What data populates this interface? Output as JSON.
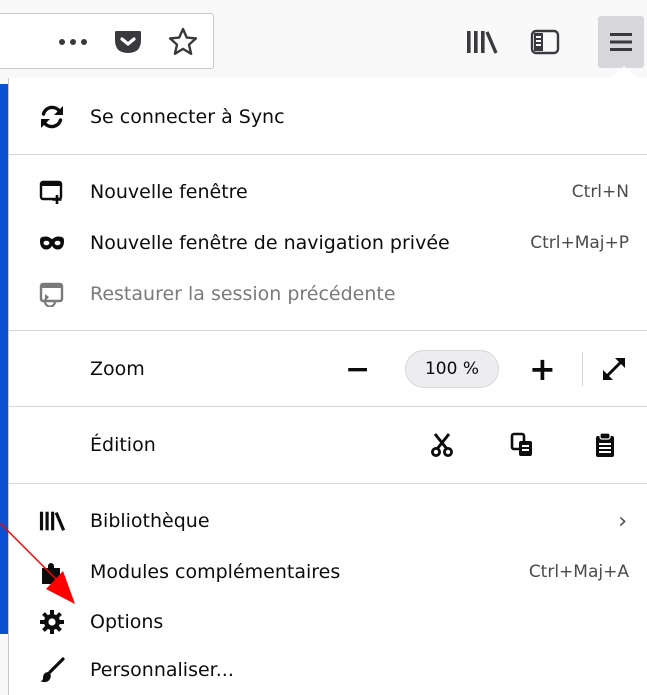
{
  "toolbar": {
    "icons": [
      "more-horizontal-icon",
      "pocket-icon",
      "bookmark-star-icon",
      "library-icon",
      "sidebar-icon",
      "hamburger-menu-icon"
    ]
  },
  "menu": {
    "sync": {
      "label": "Se connecter à Sync",
      "icon": "sync-icon"
    },
    "new_window": {
      "label": "Nouvelle fenêtre",
      "shortcut": "Ctrl+N",
      "icon": "new-window-icon"
    },
    "private_window": {
      "label": "Nouvelle fenêtre de navigation privée",
      "shortcut": "Ctrl+Maj+P",
      "icon": "private-mask-icon"
    },
    "restore_session": {
      "label": "Restaurer la session précédente",
      "icon": "restore-session-icon"
    },
    "zoom": {
      "label": "Zoom",
      "minus": "−",
      "value": "100 %",
      "plus": "+",
      "fullscreen_icon": "fullscreen-icon"
    },
    "edit": {
      "label": "Édition",
      "cut_icon": "scissors-icon",
      "copy_icon": "copy-icon",
      "paste_icon": "clipboard-icon"
    },
    "library": {
      "label": "Bibliothèque",
      "chevron": "›",
      "icon": "library-icon"
    },
    "addons": {
      "label": "Modules complémentaires",
      "shortcut": "Ctrl+Maj+A",
      "icon": "puzzle-icon"
    },
    "options": {
      "label": "Options",
      "icon": "gear-icon"
    },
    "customize": {
      "label": "Personnaliser...",
      "icon": "paintbrush-icon"
    }
  },
  "colors": {
    "accent_bar": "#0a52d1",
    "annotation_arrow": "#ff0000"
  }
}
